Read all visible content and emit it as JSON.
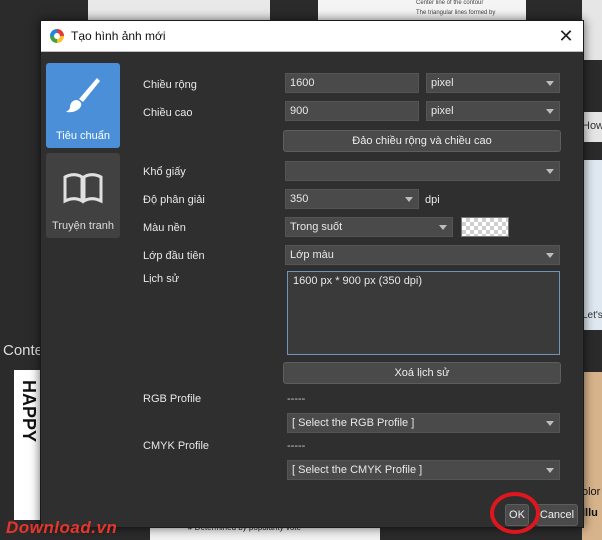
{
  "background": {
    "left_text": "Conte",
    "right_top_text": "How",
    "right_mid_text": "Let's",
    "right_bottom_text": "olor",
    "right_bottom_text2": "Illu",
    "tile_caption_1": "Center line of the contour",
    "tile_caption_2": "The triangular lines formed by",
    "tile_caption_3": "# Determined by popularity vote",
    "sidebar_words": "HAPPY"
  },
  "dialog": {
    "title": "Tạo hình ảnh mới",
    "close_symbol": "✕",
    "sidebar": [
      {
        "label": "Tiêu chuẩn",
        "icon": "paintbrush-icon",
        "active": true
      },
      {
        "label": "Truyện tranh",
        "icon": "open-book-icon",
        "active": false
      }
    ],
    "fields": {
      "width_label": "Chiều rộng",
      "width_value": "1600",
      "width_unit": "pixel",
      "height_label": "Chiều cao",
      "height_value": "900",
      "height_unit": "pixel",
      "swap_button": "Đảo chiều rộng và chiều cao",
      "paper_label": "Khổ giấy",
      "paper_value": "",
      "resolution_label": "Độ phân giải",
      "resolution_value": "350",
      "resolution_unit": "dpi",
      "bg_label": "Màu nền",
      "bg_value": "Trong suốt",
      "first_layer_label": "Lớp đầu tiên",
      "first_layer_value": "Lớp màu",
      "history_label": "Lịch sử",
      "history_entry": "1600 px * 900 px (350 dpi)",
      "clear_history_button": "Xoá lịch sử",
      "rgb_label": "RGB Profile",
      "rgb_current": "-----",
      "rgb_select": "[ Select the RGB Profile ]",
      "cmyk_label": "CMYK Profile",
      "cmyk_current": "-----",
      "cmyk_select": "[ Select the CMYK Profile ]"
    },
    "ok_button": "OK",
    "cancel_button": "Cancel"
  },
  "watermark": "Download.vn",
  "colors": {
    "accent": "#4a8fd8",
    "dialog_bg": "#2f2f2f",
    "highlight": "#e0161e"
  }
}
